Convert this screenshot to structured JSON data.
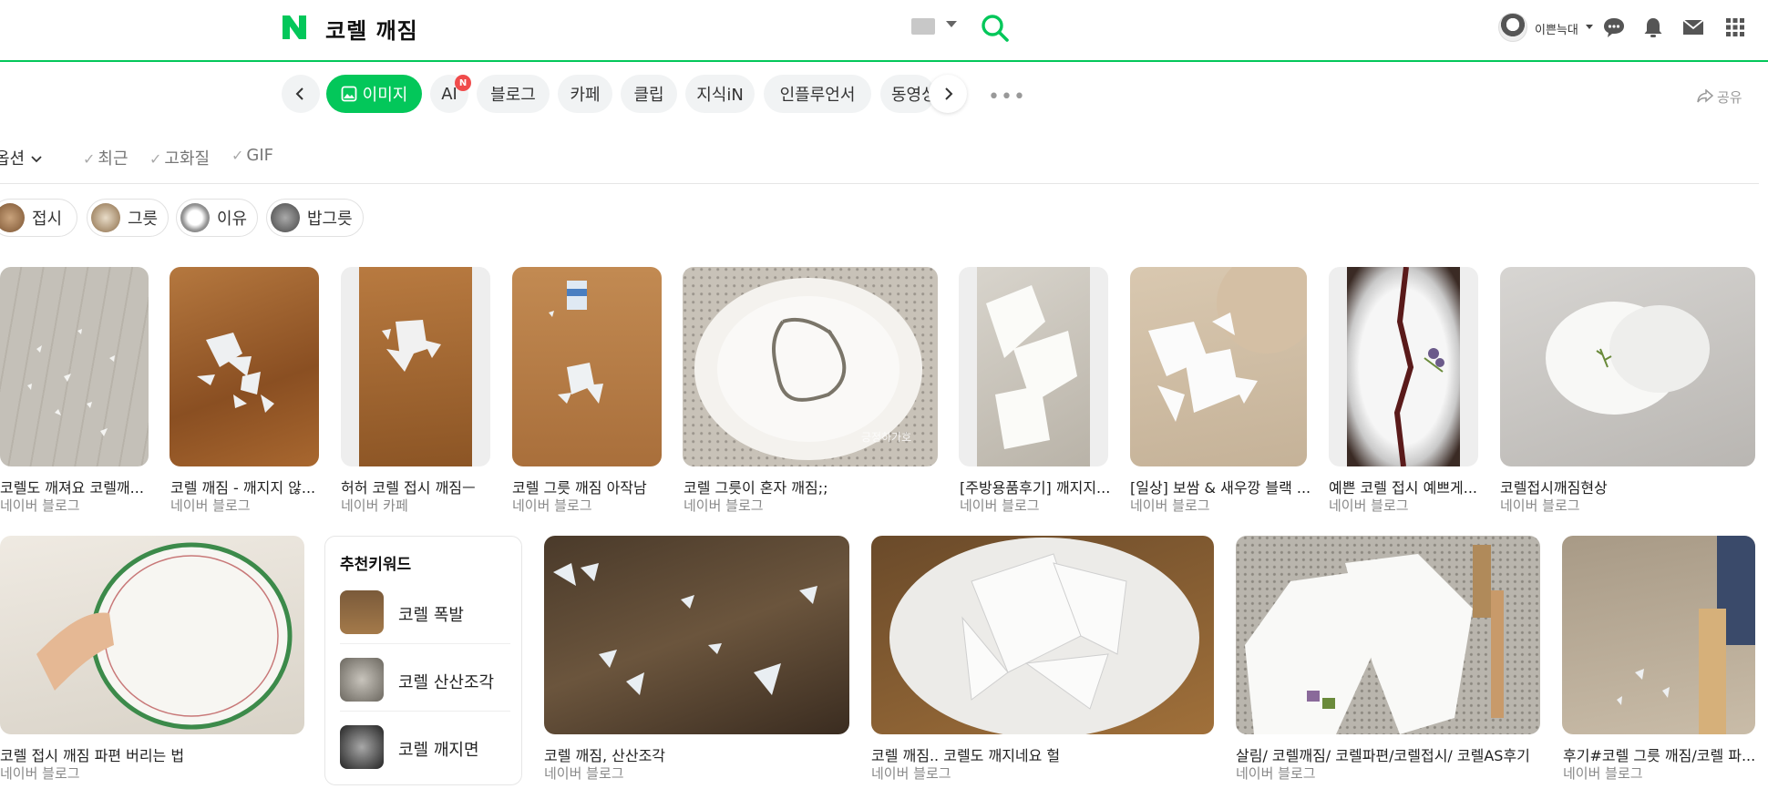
{
  "header": {
    "query": "코렐 깨짐",
    "username": "이쁜늑대"
  },
  "colors": {
    "accent": "#03c75a",
    "badge": "#f04b4b"
  },
  "tabs": [
    {
      "label": "이미지",
      "active": true
    },
    {
      "label": "AI",
      "badge": "N"
    },
    {
      "label": "블로그"
    },
    {
      "label": "카페"
    },
    {
      "label": "클립"
    },
    {
      "label": "지식iN"
    },
    {
      "label": "인플루언서"
    },
    {
      "label": "동영상"
    }
  ],
  "share_label": "공유",
  "options": {
    "menu_label": "옵션",
    "filters": [
      "최근",
      "고화질",
      "GIF"
    ]
  },
  "keyword_chips": [
    "접시",
    "그릇",
    "이유",
    "밥그릇"
  ],
  "row1": [
    {
      "title": "코렐도 깨져요 코렐깨...",
      "source": "네이버 블로그"
    },
    {
      "title": "코렐 깨짐 - 깨지지 않...",
      "source": "네이버 블로그"
    },
    {
      "title": "허허 코렐 접시 깨짐ㅡ",
      "source": "네이버 카페"
    },
    {
      "title": "코렐 그릇 깨짐 아작남",
      "source": "네이버 블로그"
    },
    {
      "title": "코렐 그릇이 혼자 깨짐;;",
      "source": "네이버 블로그",
      "watermark": "긍정하가호"
    },
    {
      "title": "[주방용품후기] 깨지지...",
      "source": "네이버 블로그"
    },
    {
      "title": "[일상] 보쌈 & 새우깡 블랙 ...",
      "source": "네이버 블로그"
    },
    {
      "title": "예쁜 코렐 접시 예쁘게...",
      "source": "네이버 블로그"
    },
    {
      "title": "코렐접시깨짐현상",
      "source": "네이버 블로그"
    }
  ],
  "recommended": {
    "title": "추천키워드",
    "items": [
      "코렐 폭발",
      "코렐 산산조각",
      "코렐 깨지면"
    ]
  },
  "row2": [
    {
      "title": "코렐 접시 깨짐 파편 버리는 법",
      "source": "네이버 블로그"
    },
    {
      "title": "코렐 깨짐, 산산조각",
      "source": "네이버 블로그"
    },
    {
      "title": "코렐 깨짐.. 코렐도 깨지네요 헐",
      "source": "네이버 블로그"
    },
    {
      "title": "살림/ 코렐깨짐/ 코렐파편/코렐접시/ 코렐AS후기",
      "source": "네이버 블로그"
    },
    {
      "title": "후기#코렐 그릇 깨짐/코렐 파...",
      "source": "네이버 블로그"
    }
  ]
}
